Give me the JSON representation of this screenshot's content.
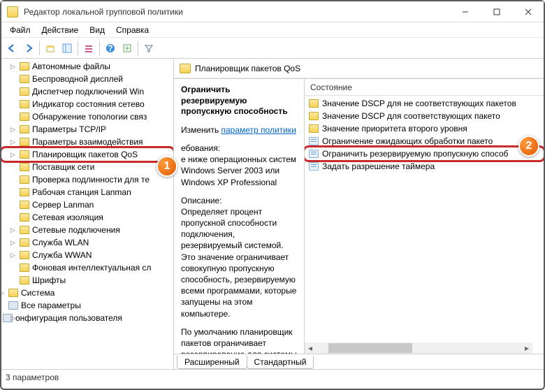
{
  "window": {
    "title": "Редактор локальной групповой политики"
  },
  "menu": {
    "file": "Файл",
    "action": "Действие",
    "view": "Вид",
    "help": "Справка"
  },
  "tree": {
    "items": [
      "Автономные файлы",
      "Беспроводной дисплей",
      "Диспетчер подключений Win",
      "Индикатор состояния сетево",
      "Обнаружение топологии связ",
      "Параметры TCP/IP",
      "Параметры взаимодействия",
      "Планировщик пакетов QoS",
      "Поставщик сети",
      "Проверка подлинности для те",
      "Рабочая станция Lanman",
      "Сервер Lanman",
      "Сетевая изоляция",
      "Сетевые подключения",
      "Служба WLAN",
      "Служба WWAN",
      "Фоновая интеллектуальная сл",
      "Шрифты"
    ],
    "sysItem": "Система",
    "allParams": "Все параметры",
    "userConfig": "онфигурация пользователя"
  },
  "right": {
    "header": "Планировщик пакетов QoS",
    "detail": {
      "title": "Ограничить резервируемую пропускную способность",
      "changeLabel": "Изменить",
      "link": "параметр политики",
      "reqLabel": "ебования:",
      "reqText": "е ниже операционных систем Windows Server 2003 или Windows XP Professional",
      "descLabel": "Описание:",
      "descText": "Определяет процент пропускной способности подключения, резервируемый системой. Это значение ограничивает совокупную пропускную способность, резервируемую всеми программами, которые запущены на этом компьютере.",
      "descText2": "По умолчанию планировщик пакетов ограничивает резервирование для системы"
    },
    "list": {
      "header": "Состояние",
      "items": [
        {
          "type": "folder",
          "label": "Значение DSCP для не соответствующих пакетов"
        },
        {
          "type": "folder",
          "label": "Значение DSCP для соответствующих пакето"
        },
        {
          "type": "folder",
          "label": "Значение приоритета второго уровня"
        },
        {
          "type": "setting",
          "label": "Ограничение ожидающих обработки пакето"
        },
        {
          "type": "setting",
          "label": "Ограничить резервируемую пропускную способ"
        },
        {
          "type": "setting",
          "label": "Задать разрешение таймера"
        }
      ]
    }
  },
  "tabs": {
    "extended": "Расширенный",
    "standard": "Стандартный"
  },
  "status": "3 параметров",
  "markers": {
    "m1": "1",
    "m2": "2"
  }
}
